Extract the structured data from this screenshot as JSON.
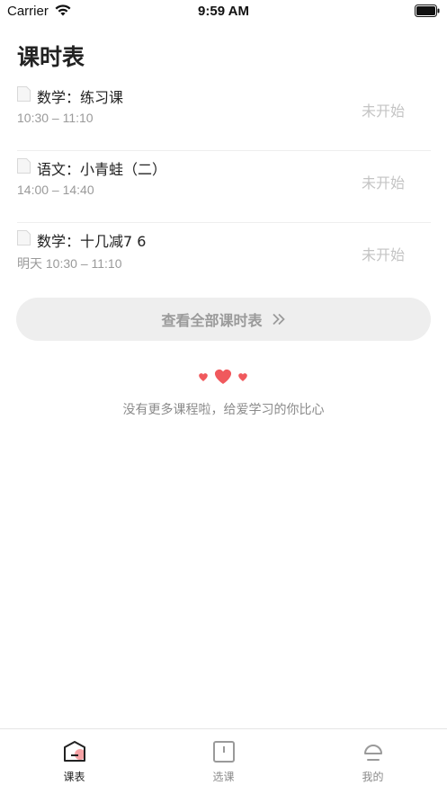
{
  "status_bar": {
    "carrier": "Carrier",
    "time": "9:59 AM"
  },
  "page": {
    "title": "课时表"
  },
  "lessons": [
    {
      "title": "数学：练习课",
      "time": "10:30 – 11:10",
      "status": "未开始"
    },
    {
      "title": "语文：小青蛙（二）",
      "time": "14:00 – 14:40",
      "status": "未开始"
    },
    {
      "title": "数学：十几减7 6",
      "time": "明天 10:30 – 11:10",
      "status": "未开始"
    }
  ],
  "view_all": {
    "label": "查看全部课时表"
  },
  "empty_hint": {
    "text": "没有更多课程啦，给爱学习的你比心"
  },
  "tabs": [
    {
      "label": "课表",
      "icon": "schedule-icon",
      "active": true
    },
    {
      "label": "选课",
      "icon": "course-select-icon",
      "active": false
    },
    {
      "label": "我的",
      "icon": "profile-icon",
      "active": false
    }
  ],
  "colors": {
    "accent": "#f0595d",
    "muted": "#c4c4c4",
    "button_bg": "#eeeeee"
  }
}
